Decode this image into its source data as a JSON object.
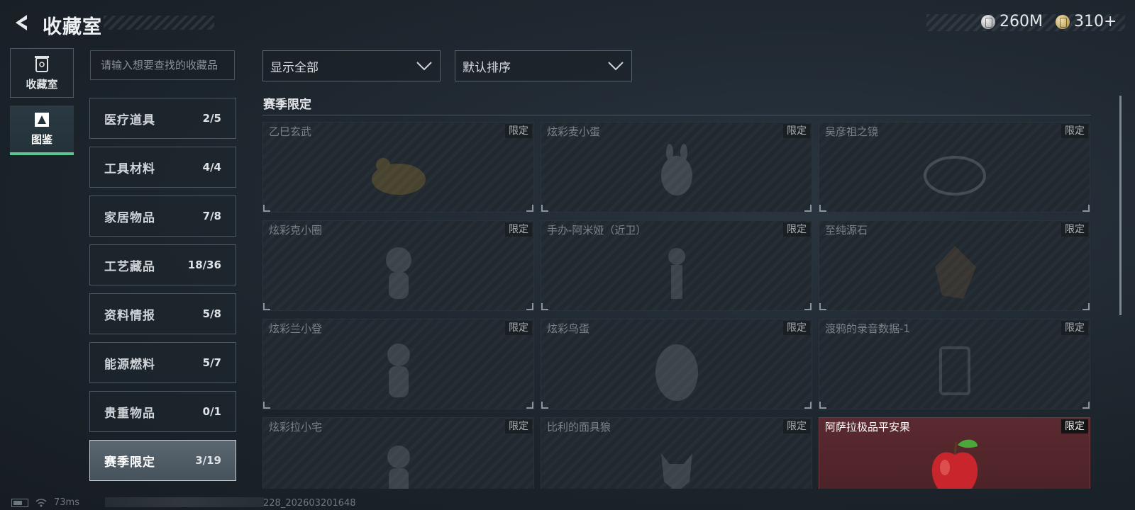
{
  "header": {
    "title": "收藏室",
    "currency": [
      {
        "icon": "silver-coin-icon",
        "value": "260M"
      },
      {
        "icon": "gold-coin-icon",
        "value": "310+"
      }
    ]
  },
  "nav": {
    "tabs": [
      {
        "label": "收藏室",
        "icon": "trash-can-icon",
        "active": false
      },
      {
        "label": "图鉴",
        "icon": "guide-book-icon",
        "active": true
      }
    ]
  },
  "search": {
    "placeholder": "请输入想要查找的收藏品"
  },
  "categories": [
    {
      "name": "医疗道具",
      "count": "2/5"
    },
    {
      "name": "工具材料",
      "count": "4/4"
    },
    {
      "name": "家居物品",
      "count": "7/8"
    },
    {
      "name": "工艺藏品",
      "count": "18/36"
    },
    {
      "name": "资料情报",
      "count": "5/8"
    },
    {
      "name": "能源燃料",
      "count": "5/7"
    },
    {
      "name": "贵重物品",
      "count": "0/1"
    },
    {
      "name": "赛季限定",
      "count": "3/19",
      "active": true
    }
  ],
  "filters": {
    "display": "显示全部",
    "sort": "默认排序"
  },
  "section": {
    "title": "赛季限定"
  },
  "items": [
    {
      "name": "乙巳玄武",
      "badge": "限定",
      "owned": false
    },
    {
      "name": "炫彩麦小蛋",
      "badge": "限定",
      "owned": false
    },
    {
      "name": "吴彦祖之镜",
      "badge": "限定",
      "owned": false
    },
    {
      "name": "炫彩克小圈",
      "badge": "限定",
      "owned": false
    },
    {
      "name": "手办-阿米娅（近卫）",
      "badge": "限定",
      "owned": false
    },
    {
      "name": "至纯源石",
      "badge": "限定",
      "owned": false
    },
    {
      "name": "炫彩兰小登",
      "badge": "限定",
      "owned": false
    },
    {
      "name": "炫彩鸟蛋",
      "badge": "限定",
      "owned": false
    },
    {
      "name": "渡鸦的录音数据-1",
      "badge": "限定",
      "owned": false
    },
    {
      "name": "炫彩拉小宅",
      "badge": "限定",
      "owned": false
    },
    {
      "name": "比利的面具狼",
      "badge": "限定",
      "owned": false
    },
    {
      "name": "阿萨拉极品平安果",
      "badge": "限定",
      "owned": true
    }
  ],
  "status": {
    "ping": "73ms",
    "build": "228_202603201648"
  },
  "colors": {
    "accent": "#5bc595",
    "owned_card": "#5a2a30"
  }
}
